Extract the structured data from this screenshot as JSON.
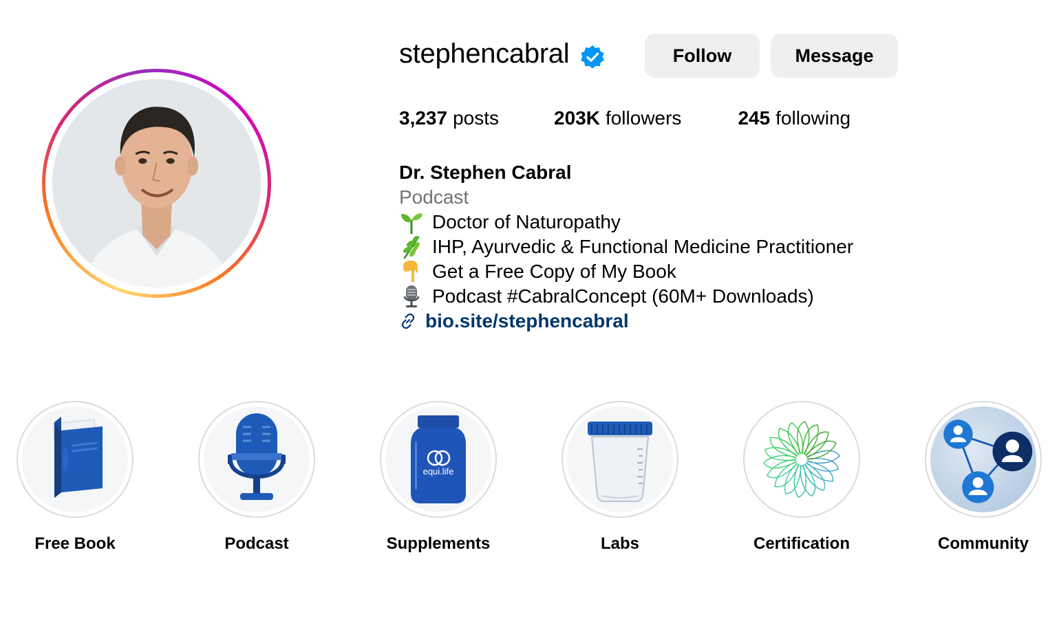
{
  "profile": {
    "username": "stephencabral",
    "verified": true,
    "follow_label": "Follow",
    "message_label": "Message"
  },
  "stats": {
    "posts_count": "3,237",
    "posts_label": "posts",
    "followers_count": "203K",
    "followers_label": "followers",
    "following_count": "245",
    "following_label": "following"
  },
  "bio": {
    "name": "Dr. Stephen Cabral",
    "category": "Podcast",
    "lines": [
      {
        "icon": "seedling-emoji",
        "text": "Doctor of Naturopathy"
      },
      {
        "icon": "herb-emoji",
        "text": "IHP, Ayurvedic & Functional Medicine Practitioner"
      },
      {
        "icon": "pointing-down-emoji",
        "text": "Get a Free Copy of My Book"
      },
      {
        "icon": "microphone-emoji",
        "text": "Podcast #CabralConcept (60M+ Downloads)"
      }
    ],
    "link": "bio.site/stephencabral"
  },
  "highlights": [
    {
      "label": "Free Book",
      "icon": "book-icon"
    },
    {
      "label": "Podcast",
      "icon": "microphone-icon"
    },
    {
      "label": "Supplements",
      "icon": "supplement-jar-icon",
      "jar_text": "equi.life"
    },
    {
      "label": "Labs",
      "icon": "specimen-cup-icon"
    },
    {
      "label": "Certification",
      "icon": "mandala-icon"
    },
    {
      "label": "Community",
      "icon": "network-icon"
    }
  ],
  "colors": {
    "link": "#00376b",
    "verified": "#0095f6",
    "button_bg": "#efefef",
    "category": "#737373"
  }
}
